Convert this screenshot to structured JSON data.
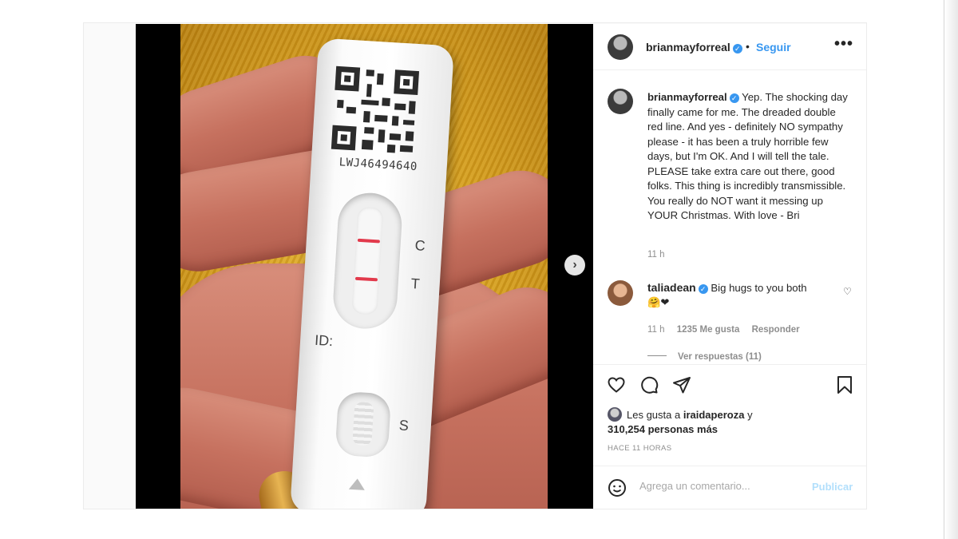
{
  "post": {
    "author": "brianmayforreal",
    "follow_label": "Seguir",
    "separator": "•",
    "more_label": "•••",
    "verified_mark": "✓",
    "caption_text": "Yep. The shocking day finally came for me. The dreaded double red line. And yes - definitely NO sympathy please - it has been a truly horrible few days, but I'm OK. And I will tell the tale. PLEASE take extra care out there, good folks. This thing is incredibly transmissible. You really do NOT want it messing up YOUR Christmas. With love - Bri",
    "caption_time": "11 h",
    "posted_ago": "HACE 11 HORAS"
  },
  "media": {
    "test_lot_number": "LWJ46494640",
    "label_c": "C",
    "label_t": "T",
    "label_id": "ID:",
    "label_s": "S",
    "next_arrow": "›"
  },
  "comment": {
    "author": "taliadean",
    "text": "Big hugs to you both",
    "emojis": "🤗❤",
    "time": "11 h",
    "likes": "1235 Me gusta",
    "reply_label": "Responder",
    "view_replies": "Ver respuestas (11)"
  },
  "likes": {
    "prefix": "Les gusta a",
    "user": "iraidaperoza",
    "connector": "y",
    "count_text": "310,254 personas más"
  },
  "composer": {
    "placeholder": "Agrega un comentario...",
    "publish_label": "Publicar"
  },
  "icons": {
    "actions": [
      "heart-icon",
      "comment-icon",
      "share-icon",
      "bookmark-icon"
    ],
    "composer": "smiley-icon"
  },
  "colors": {
    "accent": "#3897f0",
    "test_line": "#e23a4c",
    "publish_disabled": "#b2dffc"
  }
}
